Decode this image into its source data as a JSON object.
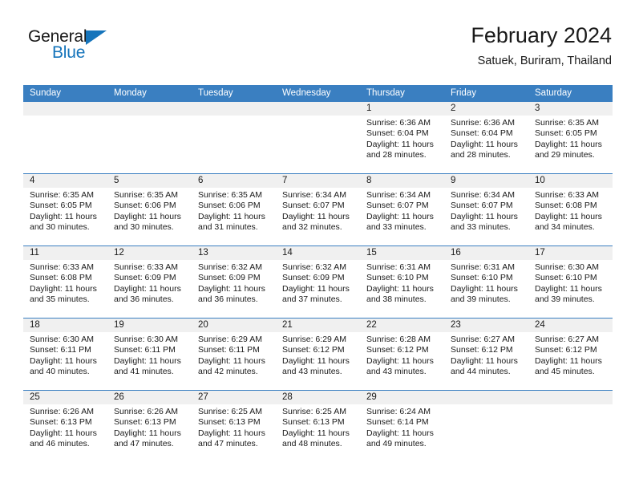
{
  "brand": {
    "name_dark": "General",
    "name_blue": "Blue",
    "triangle_color": "#1574bb"
  },
  "header": {
    "title": "February 2024",
    "subtitle": "Satuek, Buriram, Thailand"
  },
  "theme": {
    "header_blue": "#3a7fc1",
    "daynum_band": "#f0f0f0",
    "text": "#1a1a1a"
  },
  "weekdays": [
    "Sunday",
    "Monday",
    "Tuesday",
    "Wednesday",
    "Thursday",
    "Friday",
    "Saturday"
  ],
  "weeks": [
    [
      {
        "day": "",
        "sunrise": "",
        "sunset": "",
        "daylight_line1": "",
        "daylight_line2": ""
      },
      {
        "day": "",
        "sunrise": "",
        "sunset": "",
        "daylight_line1": "",
        "daylight_line2": ""
      },
      {
        "day": "",
        "sunrise": "",
        "sunset": "",
        "daylight_line1": "",
        "daylight_line2": ""
      },
      {
        "day": "",
        "sunrise": "",
        "sunset": "",
        "daylight_line1": "",
        "daylight_line2": ""
      },
      {
        "day": "1",
        "sunrise": "Sunrise: 6:36 AM",
        "sunset": "Sunset: 6:04 PM",
        "daylight_line1": "Daylight: 11 hours",
        "daylight_line2": "and 28 minutes."
      },
      {
        "day": "2",
        "sunrise": "Sunrise: 6:36 AM",
        "sunset": "Sunset: 6:04 PM",
        "daylight_line1": "Daylight: 11 hours",
        "daylight_line2": "and 28 minutes."
      },
      {
        "day": "3",
        "sunrise": "Sunrise: 6:35 AM",
        "sunset": "Sunset: 6:05 PM",
        "daylight_line1": "Daylight: 11 hours",
        "daylight_line2": "and 29 minutes."
      }
    ],
    [
      {
        "day": "4",
        "sunrise": "Sunrise: 6:35 AM",
        "sunset": "Sunset: 6:05 PM",
        "daylight_line1": "Daylight: 11 hours",
        "daylight_line2": "and 30 minutes."
      },
      {
        "day": "5",
        "sunrise": "Sunrise: 6:35 AM",
        "sunset": "Sunset: 6:06 PM",
        "daylight_line1": "Daylight: 11 hours",
        "daylight_line2": "and 30 minutes."
      },
      {
        "day": "6",
        "sunrise": "Sunrise: 6:35 AM",
        "sunset": "Sunset: 6:06 PM",
        "daylight_line1": "Daylight: 11 hours",
        "daylight_line2": "and 31 minutes."
      },
      {
        "day": "7",
        "sunrise": "Sunrise: 6:34 AM",
        "sunset": "Sunset: 6:07 PM",
        "daylight_line1": "Daylight: 11 hours",
        "daylight_line2": "and 32 minutes."
      },
      {
        "day": "8",
        "sunrise": "Sunrise: 6:34 AM",
        "sunset": "Sunset: 6:07 PM",
        "daylight_line1": "Daylight: 11 hours",
        "daylight_line2": "and 33 minutes."
      },
      {
        "day": "9",
        "sunrise": "Sunrise: 6:34 AM",
        "sunset": "Sunset: 6:07 PM",
        "daylight_line1": "Daylight: 11 hours",
        "daylight_line2": "and 33 minutes."
      },
      {
        "day": "10",
        "sunrise": "Sunrise: 6:33 AM",
        "sunset": "Sunset: 6:08 PM",
        "daylight_line1": "Daylight: 11 hours",
        "daylight_line2": "and 34 minutes."
      }
    ],
    [
      {
        "day": "11",
        "sunrise": "Sunrise: 6:33 AM",
        "sunset": "Sunset: 6:08 PM",
        "daylight_line1": "Daylight: 11 hours",
        "daylight_line2": "and 35 minutes."
      },
      {
        "day": "12",
        "sunrise": "Sunrise: 6:33 AM",
        "sunset": "Sunset: 6:09 PM",
        "daylight_line1": "Daylight: 11 hours",
        "daylight_line2": "and 36 minutes."
      },
      {
        "day": "13",
        "sunrise": "Sunrise: 6:32 AM",
        "sunset": "Sunset: 6:09 PM",
        "daylight_line1": "Daylight: 11 hours",
        "daylight_line2": "and 36 minutes."
      },
      {
        "day": "14",
        "sunrise": "Sunrise: 6:32 AM",
        "sunset": "Sunset: 6:09 PM",
        "daylight_line1": "Daylight: 11 hours",
        "daylight_line2": "and 37 minutes."
      },
      {
        "day": "15",
        "sunrise": "Sunrise: 6:31 AM",
        "sunset": "Sunset: 6:10 PM",
        "daylight_line1": "Daylight: 11 hours",
        "daylight_line2": "and 38 minutes."
      },
      {
        "day": "16",
        "sunrise": "Sunrise: 6:31 AM",
        "sunset": "Sunset: 6:10 PM",
        "daylight_line1": "Daylight: 11 hours",
        "daylight_line2": "and 39 minutes."
      },
      {
        "day": "17",
        "sunrise": "Sunrise: 6:30 AM",
        "sunset": "Sunset: 6:10 PM",
        "daylight_line1": "Daylight: 11 hours",
        "daylight_line2": "and 39 minutes."
      }
    ],
    [
      {
        "day": "18",
        "sunrise": "Sunrise: 6:30 AM",
        "sunset": "Sunset: 6:11 PM",
        "daylight_line1": "Daylight: 11 hours",
        "daylight_line2": "and 40 minutes."
      },
      {
        "day": "19",
        "sunrise": "Sunrise: 6:30 AM",
        "sunset": "Sunset: 6:11 PM",
        "daylight_line1": "Daylight: 11 hours",
        "daylight_line2": "and 41 minutes."
      },
      {
        "day": "20",
        "sunrise": "Sunrise: 6:29 AM",
        "sunset": "Sunset: 6:11 PM",
        "daylight_line1": "Daylight: 11 hours",
        "daylight_line2": "and 42 minutes."
      },
      {
        "day": "21",
        "sunrise": "Sunrise: 6:29 AM",
        "sunset": "Sunset: 6:12 PM",
        "daylight_line1": "Daylight: 11 hours",
        "daylight_line2": "and 43 minutes."
      },
      {
        "day": "22",
        "sunrise": "Sunrise: 6:28 AM",
        "sunset": "Sunset: 6:12 PM",
        "daylight_line1": "Daylight: 11 hours",
        "daylight_line2": "and 43 minutes."
      },
      {
        "day": "23",
        "sunrise": "Sunrise: 6:27 AM",
        "sunset": "Sunset: 6:12 PM",
        "daylight_line1": "Daylight: 11 hours",
        "daylight_line2": "and 44 minutes."
      },
      {
        "day": "24",
        "sunrise": "Sunrise: 6:27 AM",
        "sunset": "Sunset: 6:12 PM",
        "daylight_line1": "Daylight: 11 hours",
        "daylight_line2": "and 45 minutes."
      }
    ],
    [
      {
        "day": "25",
        "sunrise": "Sunrise: 6:26 AM",
        "sunset": "Sunset: 6:13 PM",
        "daylight_line1": "Daylight: 11 hours",
        "daylight_line2": "and 46 minutes."
      },
      {
        "day": "26",
        "sunrise": "Sunrise: 6:26 AM",
        "sunset": "Sunset: 6:13 PM",
        "daylight_line1": "Daylight: 11 hours",
        "daylight_line2": "and 47 minutes."
      },
      {
        "day": "27",
        "sunrise": "Sunrise: 6:25 AM",
        "sunset": "Sunset: 6:13 PM",
        "daylight_line1": "Daylight: 11 hours",
        "daylight_line2": "and 47 minutes."
      },
      {
        "day": "28",
        "sunrise": "Sunrise: 6:25 AM",
        "sunset": "Sunset: 6:13 PM",
        "daylight_line1": "Daylight: 11 hours",
        "daylight_line2": "and 48 minutes."
      },
      {
        "day": "29",
        "sunrise": "Sunrise: 6:24 AM",
        "sunset": "Sunset: 6:14 PM",
        "daylight_line1": "Daylight: 11 hours",
        "daylight_line2": "and 49 minutes."
      },
      {
        "day": "",
        "sunrise": "",
        "sunset": "",
        "daylight_line1": "",
        "daylight_line2": ""
      },
      {
        "day": "",
        "sunrise": "",
        "sunset": "",
        "daylight_line1": "",
        "daylight_line2": ""
      }
    ]
  ]
}
